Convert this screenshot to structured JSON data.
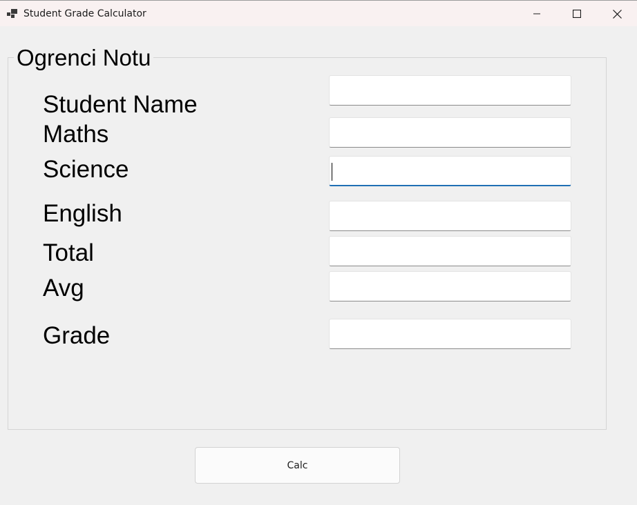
{
  "window": {
    "title": "Student Grade Calculator",
    "icon": "app-window-icon",
    "controls": [
      "minimize-icon",
      "maximize-icon",
      "close-icon"
    ]
  },
  "group": {
    "title": "Ogrenci Notu"
  },
  "fields": {
    "student_name": {
      "label": "Student Name",
      "value": ""
    },
    "maths": {
      "label": "Maths",
      "value": ""
    },
    "science": {
      "label": "Science",
      "value": "",
      "focused": true
    },
    "english": {
      "label": "English",
      "value": ""
    },
    "total": {
      "label": "Total",
      "value": ""
    },
    "avg": {
      "label": "Avg",
      "value": ""
    },
    "grade": {
      "label": "Grade",
      "value": ""
    }
  },
  "buttons": {
    "calc": "Calc"
  },
  "colors": {
    "focus_accent": "#1f6fb4",
    "background": "#f0f0f0"
  }
}
